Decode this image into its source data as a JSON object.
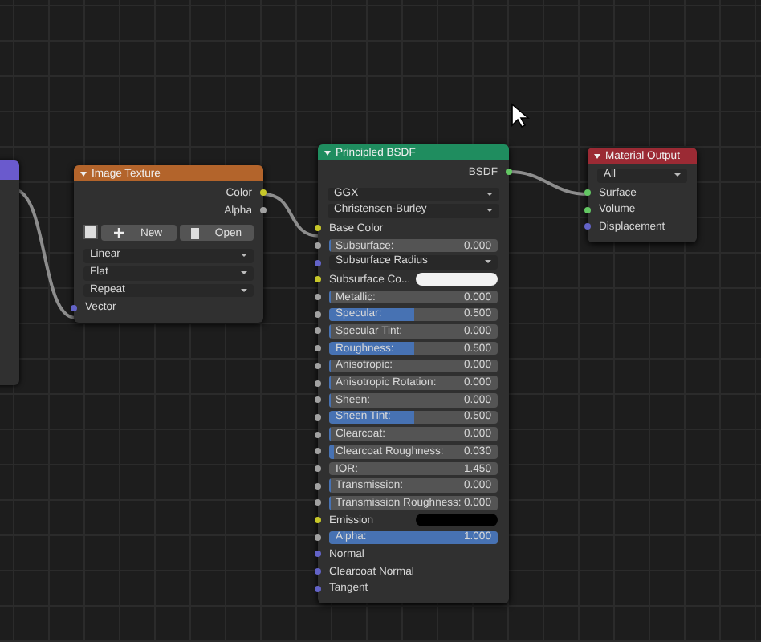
{
  "image_texture": {
    "title": "Image Texture",
    "outputs": [
      {
        "label": "Color",
        "color": "#c7c729"
      },
      {
        "label": "Alpha",
        "color": "#a1a1a1"
      }
    ],
    "new_button": "New",
    "open_button": "Open",
    "dropdowns": [
      "Linear",
      "Flat",
      "Repeat"
    ],
    "inputs": [
      {
        "label": "Vector",
        "color": "#6363c7"
      }
    ]
  },
  "principled": {
    "title": "Principled BSDF",
    "output": {
      "label": "BSDF",
      "color": "#63c763"
    },
    "dropdowns": [
      "GGX",
      "Christensen-Burley"
    ],
    "rows": [
      {
        "kind": "label",
        "label": "Base Color",
        "color": "#c7c729"
      },
      {
        "kind": "slider",
        "label": "Subsurface:",
        "value": "0.000",
        "level": 0,
        "color": "#a1a1a1"
      },
      {
        "kind": "dropdown",
        "label": "Subsurface Radius",
        "color": "#6363c7"
      },
      {
        "kind": "color",
        "label": "Subsurface Co...",
        "swatch": {
          "color": "#f2f2f2"
        },
        "color": "#c7c729"
      },
      {
        "kind": "slider",
        "label": "Metallic:",
        "value": "0.000",
        "level": 0,
        "color": "#a1a1a1"
      },
      {
        "kind": "slider",
        "label": "Specular:",
        "value": "0.500",
        "level": 0.5,
        "color": "#a1a1a1"
      },
      {
        "kind": "slider",
        "label": "Specular Tint:",
        "value": "0.000",
        "level": 0,
        "color": "#a1a1a1"
      },
      {
        "kind": "slider",
        "label": "Roughness:",
        "value": "0.500",
        "level": 0.5,
        "color": "#a1a1a1"
      },
      {
        "kind": "slider",
        "label": "Anisotropic:",
        "value": "0.000",
        "level": 0,
        "color": "#a1a1a1"
      },
      {
        "kind": "slider",
        "label": "Anisotropic Rotation:",
        "value": "0.000",
        "level": 0,
        "color": "#a1a1a1"
      },
      {
        "kind": "slider",
        "label": "Sheen:",
        "value": "0.000",
        "level": 0,
        "color": "#a1a1a1"
      },
      {
        "kind": "slider",
        "label": "Sheen Tint:",
        "value": "0.500",
        "level": 0.5,
        "color": "#a1a1a1"
      },
      {
        "kind": "slider",
        "label": "Clearcoat:",
        "value": "0.000",
        "level": 0,
        "color": "#a1a1a1"
      },
      {
        "kind": "slider",
        "label": "Clearcoat Roughness:",
        "value": "0.030",
        "level": 0.03,
        "color": "#a1a1a1"
      },
      {
        "kind": "number",
        "label": "IOR:",
        "value": "1.450",
        "color": "#a1a1a1"
      },
      {
        "kind": "slider",
        "label": "Transmission:",
        "value": "0.000",
        "level": 0,
        "color": "#a1a1a1"
      },
      {
        "kind": "slider",
        "label": "Transmission Roughness:",
        "value": "0.000",
        "level": 0,
        "color": "#a1a1a1"
      },
      {
        "kind": "color",
        "label": "Emission",
        "swatch": {
          "color": "#000000"
        },
        "color": "#c7c729"
      },
      {
        "kind": "slider",
        "label": "Alpha:",
        "value": "1.000",
        "level": 1,
        "color": "#a1a1a1"
      },
      {
        "kind": "label",
        "label": "Normal",
        "color": "#6363c7"
      },
      {
        "kind": "label",
        "label": "Clearcoat Normal",
        "color": "#6363c7"
      },
      {
        "kind": "label",
        "label": "Tangent",
        "color": "#6363c7"
      }
    ]
  },
  "material_output": {
    "title": "Material Output",
    "dropdown": "All",
    "inputs": [
      {
        "label": "Surface",
        "color": "#63c763"
      },
      {
        "label": "Volume",
        "color": "#63c763"
      },
      {
        "label": "Displacement",
        "color": "#6363c7"
      }
    ]
  }
}
